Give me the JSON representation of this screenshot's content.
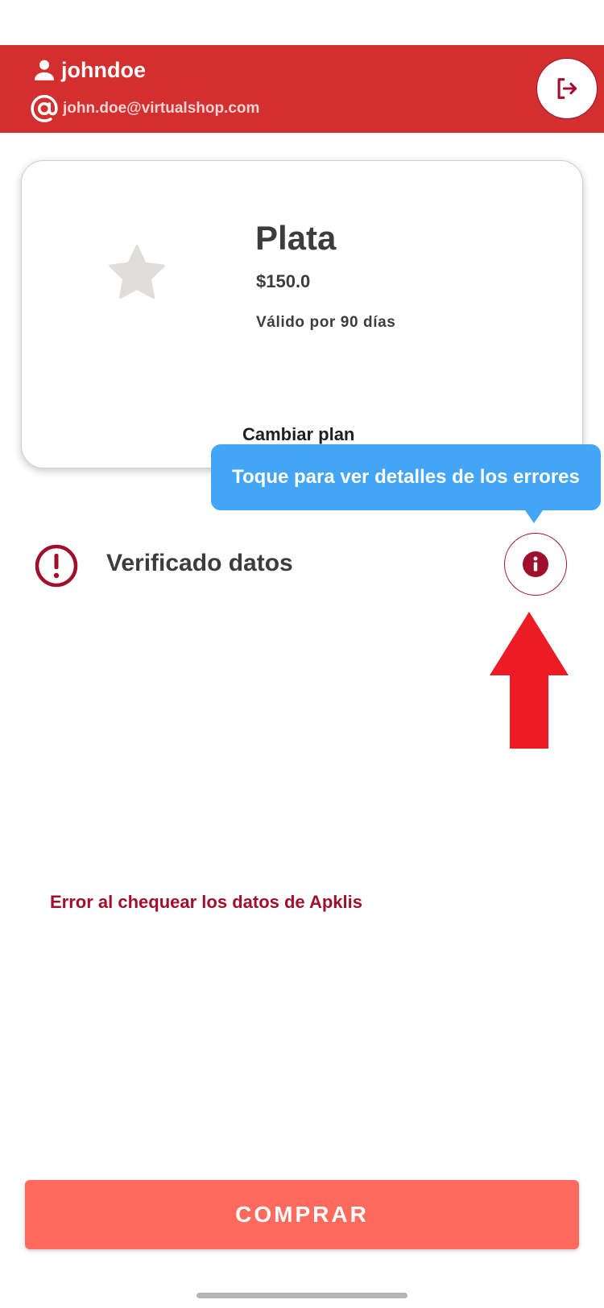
{
  "header": {
    "username": "johndoe",
    "email": "john.doe@virtualshop.com",
    "user_icon": "person-icon",
    "email_icon": "at-sign-icon",
    "logout_icon": "logout-icon",
    "background_color": "#d32f2f"
  },
  "plan": {
    "icon": "star-icon",
    "name": "Plata",
    "price": "$150.0",
    "validity": "Válido por 90 días",
    "change_label": "Cambiar plan"
  },
  "tooltip": {
    "text": "Toque para ver detalles de los errores",
    "color": "#42a5f5"
  },
  "status": {
    "icon": "alert-circle-icon",
    "label": "Verificado datos",
    "info_icon": "info-icon"
  },
  "error_message": "Error al chequear los datos de Apklis",
  "buy_button": {
    "label": "COMPRAR",
    "color": "#ff6a5c"
  },
  "accent_color": "#a00f2c",
  "pointer_arrow": {
    "icon": "arrow-up-icon",
    "color": "#ed1c24"
  }
}
